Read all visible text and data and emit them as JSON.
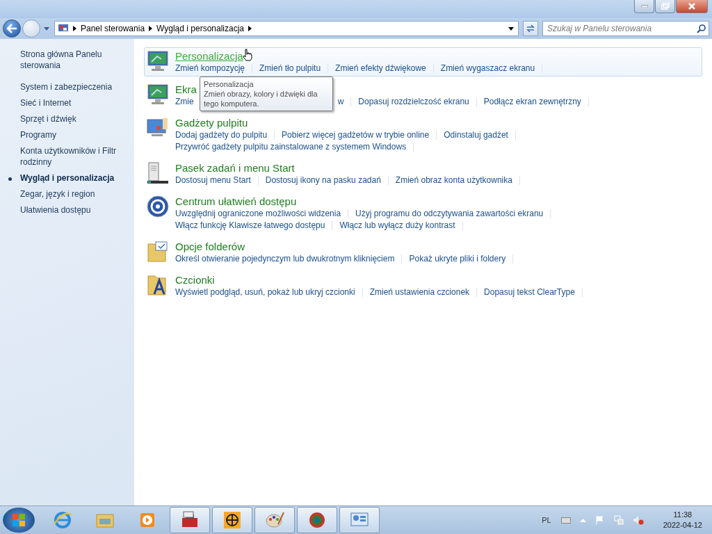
{
  "window": {
    "nav": {
      "breadcrumbs": [
        "Panel sterowania",
        "Wygląd i personalizacja"
      ]
    },
    "search": {
      "placeholder": "Szukaj w Panelu sterowania"
    }
  },
  "sidebar": {
    "items": [
      {
        "label": "Strona główna Panelu sterowania",
        "selected": false
      },
      {
        "label": "System i zabezpieczenia",
        "selected": false
      },
      {
        "label": "Sieć i Internet",
        "selected": false
      },
      {
        "label": "Sprzęt i dźwięk",
        "selected": false
      },
      {
        "label": "Programy",
        "selected": false
      },
      {
        "label": "Konta użytkowników i Filtr rodzinny",
        "selected": false
      },
      {
        "label": "Wygląd i personalizacja",
        "selected": true
      },
      {
        "label": "Zegar, język i region",
        "selected": false
      },
      {
        "label": "Ułatwienia dostępu",
        "selected": false
      }
    ]
  },
  "categories": [
    {
      "kind": "personalization",
      "title": "Personalizacja",
      "hovered": true,
      "rows": [
        [
          "Zmień kompozycję",
          "Zmień tło pulpitu",
          "Zmień efekty dźwiękowe",
          "Zmień wygaszacz ekranu"
        ]
      ]
    },
    {
      "kind": "display",
      "title": "Ekra",
      "hovered": false,
      "rows": [
        [
          "Zmie",
          "w",
          "Dopasuj rozdzielczość ekranu",
          "Podłącz ekran zewnętrzny"
        ]
      ]
    },
    {
      "kind": "gadgets",
      "title": "Gadżety pulpitu",
      "hovered": false,
      "rows": [
        [
          "Dodaj gadżety do pulpitu",
          "Pobierz więcej gadżetów w trybie online",
          "Odinstaluj gadżet"
        ],
        [
          "Przywróć gadżety pulpitu zainstalowane z systemem Windows"
        ]
      ]
    },
    {
      "kind": "taskbar",
      "title": "Pasek zadań i menu Start",
      "hovered": false,
      "rows": [
        [
          "Dostosuj menu Start",
          "Dostosuj ikony na pasku zadań",
          "Zmień obraz konta użytkownika"
        ]
      ]
    },
    {
      "kind": "access",
      "title": "Centrum ułatwień dostępu",
      "hovered": false,
      "rows": [
        [
          "Uwzględnij ograniczone możliwości widzenia",
          "Użyj programu do odczytywania zawartości ekranu"
        ],
        [
          "Włącz funkcję Klawisze łatwego dostępu",
          "Włącz lub wyłącz duży kontrast"
        ]
      ]
    },
    {
      "kind": "folder",
      "title": "Opcje folderów",
      "hovered": false,
      "rows": [
        [
          "Określ otwieranie pojedynczym lub dwukrotnym kliknięciem",
          "Pokaż ukryte pliki i foldery"
        ]
      ]
    },
    {
      "kind": "fonts",
      "title": "Czcionki",
      "hovered": false,
      "rows": [
        [
          "Wyświetl podgląd, usuń, pokaż lub ukryj czcionki",
          "Zmień ustawienia czcionek",
          "Dopasuj tekst ClearType"
        ]
      ]
    }
  ],
  "tooltip": {
    "title": "Personalizacja",
    "text": "Zmień obrazy, kolory i dźwięki dla tego komputera."
  },
  "taskbar": {
    "items": [
      {
        "kind": "ie",
        "running": false
      },
      {
        "kind": "explorer",
        "running": false
      },
      {
        "kind": "media",
        "running": false
      },
      {
        "kind": "toolbox",
        "running": true
      },
      {
        "kind": "globe",
        "running": true
      },
      {
        "kind": "paint",
        "running": true
      },
      {
        "kind": "spiral",
        "running": true
      },
      {
        "kind": "panel",
        "running": true
      }
    ],
    "language": "PL",
    "time": "11:38",
    "date": "2022-04-12"
  }
}
